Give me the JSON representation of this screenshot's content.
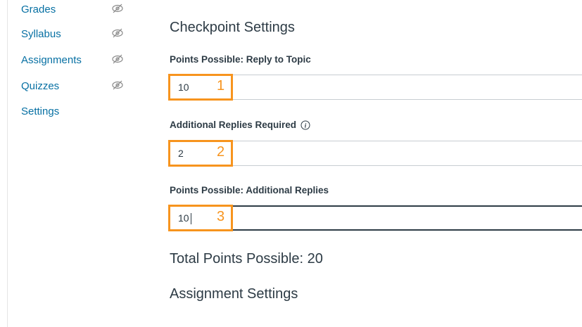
{
  "sidebar": {
    "items": [
      {
        "label": "Grades",
        "hidden": true
      },
      {
        "label": "Syllabus",
        "hidden": true
      },
      {
        "label": "Assignments",
        "hidden": true
      },
      {
        "label": "Quizzes",
        "hidden": true
      },
      {
        "label": "Settings",
        "hidden": false
      }
    ]
  },
  "checkpoint": {
    "title": "Checkpoint Settings",
    "reply_to_topic": {
      "label": "Points Possible: Reply to Topic",
      "value": "10",
      "callout": "1"
    },
    "additional_replies_required": {
      "label": "Additional Replies Required",
      "value": "2",
      "callout": "2",
      "info_icon": "info-icon"
    },
    "additional_replies_points": {
      "label": "Points Possible: Additional Replies",
      "value": "10",
      "callout": "3"
    },
    "total": "Total Points Possible: 20"
  },
  "assignment_settings": {
    "title": "Assignment Settings"
  },
  "colors": {
    "link": "#0770a3",
    "callout": "#f7941e",
    "text": "#2d3b45"
  }
}
